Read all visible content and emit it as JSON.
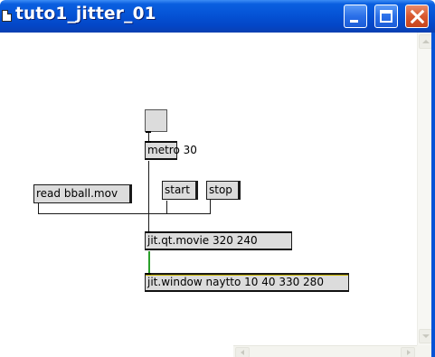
{
  "window": {
    "title": "tuto1_jitter_01"
  },
  "patch": {
    "objects": {
      "metro": "metro 30",
      "read": "read bball.mov",
      "start": "start",
      "stop": "stop",
      "qtmovie": "jit.qt.movie 320 240",
      "window": "jit.window naytto 10 40 330 280"
    }
  },
  "colors": {
    "titlebar": "#0553d6",
    "object_fill": "#dcdcdc",
    "signal_cord": "#2aa02a"
  }
}
